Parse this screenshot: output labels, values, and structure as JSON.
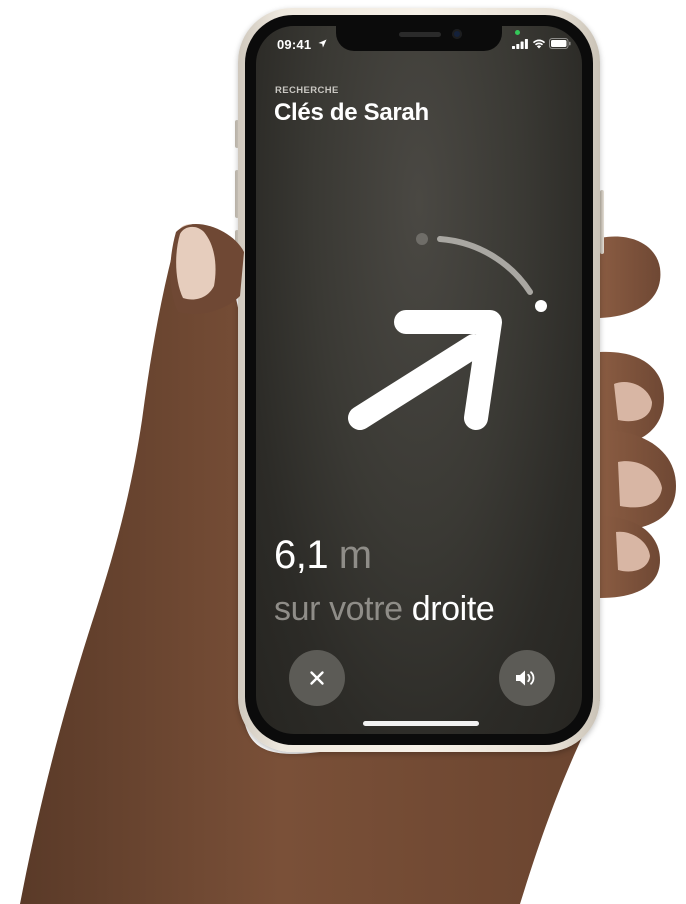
{
  "status_bar": {
    "time": "09:41",
    "icons": [
      "location-arrow-icon",
      "signal-bars-icon",
      "wifi-icon",
      "battery-icon"
    ],
    "camera_indicator_color": "#34c759"
  },
  "header": {
    "eyebrow": "RECHERCHE",
    "title": "Clés de Sarah"
  },
  "guidance": {
    "distance_value": "6,1",
    "distance_unit": "m",
    "direction_prefix": "sur votre",
    "direction_word": "droite",
    "arrow_icon": "arrow-up-right-icon"
  },
  "controls": {
    "close_icon": "close-icon",
    "sound_icon": "speaker-icon"
  },
  "colors": {
    "screen_background": "#3a3934",
    "primary_text": "#ffffff",
    "secondary_text": "#8f8d88",
    "button_fill": "#5c5b56",
    "phone_frame": "#f6f1e8"
  }
}
